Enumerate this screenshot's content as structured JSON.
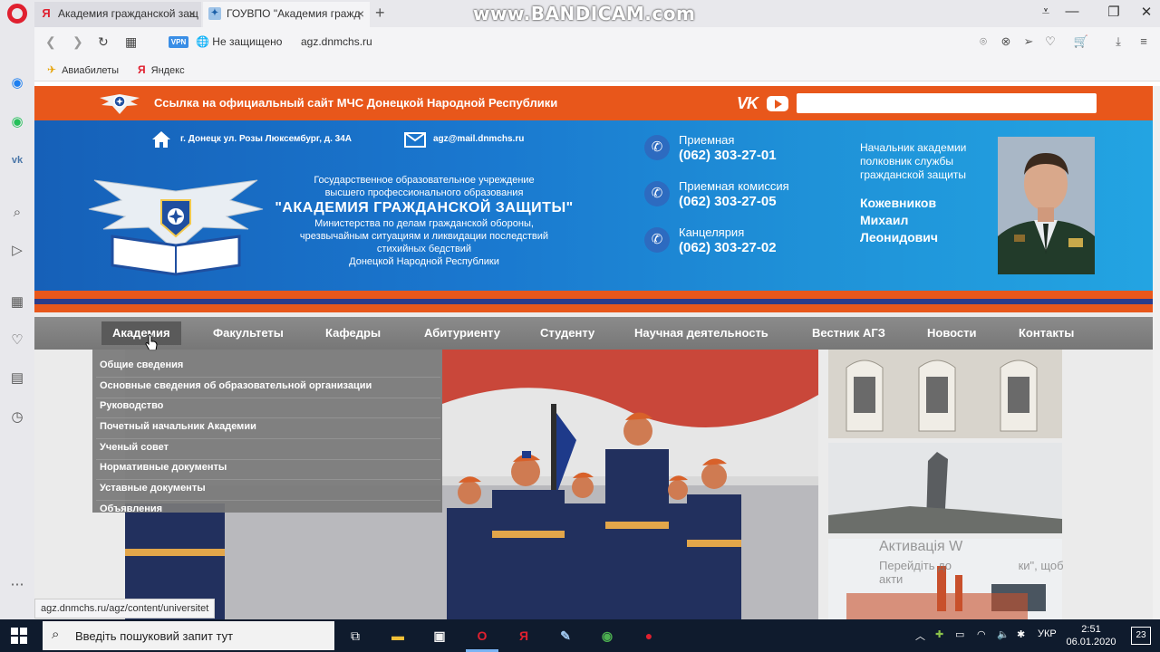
{
  "browser": {
    "tabs": [
      {
        "title": "Академия гражданской защ",
        "icon": "yandex-icon"
      },
      {
        "title": "ГОУВПО \"Академия гражд",
        "icon": "site-favicon"
      }
    ],
    "watermark": "www.BANDICAM.com",
    "address": {
      "vpn": "VPN",
      "security": "Не защищено",
      "url": "agz.dnmchs.ru"
    },
    "bookmarks": [
      {
        "label": "Авиабилеты",
        "icon": "plane-icon"
      },
      {
        "label": "Яндекс",
        "icon": "yandex-icon"
      }
    ],
    "status_url": "agz.dnmchs.ru/agz/content/universitet"
  },
  "site": {
    "top_link": "Ссылка на официальный сайт МЧС Донецкой Народной Республики",
    "search_placeholder": "",
    "address": "г. Донецк ул. Розы Люксембург, д. 34А",
    "email": "agz@mail.dnmchs.ru",
    "institution": {
      "line1": "Государственное образовательное учреждение",
      "line2": "высшего профессионального образования",
      "name": "\"АКАДЕМИЯ ГРАЖДАНСКОЙ ЗАЩИТЫ\"",
      "line3": "Министерства по делам гражданской обороны,",
      "line4": "чрезвычайным ситуациям и ликвидации последствий",
      "line5": "стихийных бедствий",
      "line6": "Донецкой Народной Республики"
    },
    "phones": [
      {
        "label": "Приемная",
        "number": "(062) 303-27-01"
      },
      {
        "label": "Приемная комиссия",
        "number": "(062) 303-27-05"
      },
      {
        "label": "Канцелярия",
        "number": "(062) 303-27-02"
      }
    ],
    "chief": {
      "title_line1": "Начальник академии",
      "title_line2": "полковник службы",
      "title_line3": "гражданской защиты",
      "name_line1": "Кожевников",
      "name_line2": "Михаил",
      "name_line3": "Леонидович"
    },
    "nav": [
      "Академия",
      "Факультеты",
      "Кафедры",
      "Абитуриенту",
      "Студенту",
      "Научная деятельность",
      "Вестник АГЗ",
      "Новости",
      "Контакты"
    ],
    "dropdown": [
      "Общие сведения",
      "Основные сведения об образовательной организации",
      "Руководство",
      "Почетный начальник Академии",
      "Ученый совет",
      "Нормативные документы",
      "Уставные документы",
      "Объявления"
    ],
    "activation": {
      "title": "Активація W",
      "text": "Перейдіть до",
      "text_tail": "ки\", щоб",
      "text2": "акти"
    }
  },
  "taskbar": {
    "search_placeholder": "Введіть пошуковий запит тут",
    "language": "УКР",
    "time": "2:51",
    "date": "06.01.2020",
    "notifications": "23"
  },
  "colors": {
    "orange": "#e8571b",
    "blue": "#1a78cf",
    "nav_gray": "#808080"
  }
}
